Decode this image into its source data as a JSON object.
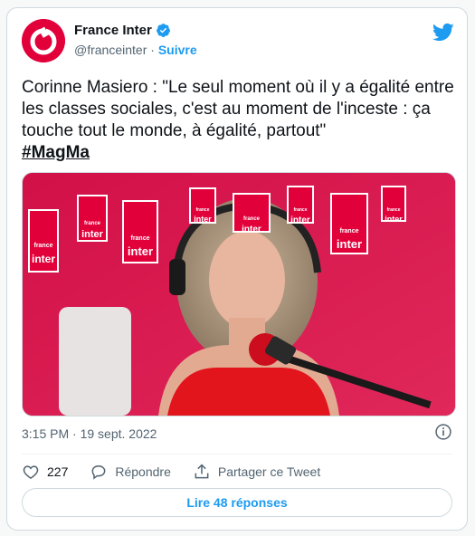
{
  "account": {
    "display_name": "France Inter",
    "handle": "@franceinter",
    "separator": "·",
    "follow_label": "Suivre"
  },
  "tweet": {
    "text": "Corinne Masiero  : \"Le seul moment où il y a égalité entre les classes sociales, c'est au moment de l'inceste : ça touche tout le monde, à égalité, partout\"",
    "hashtag": "#MagMa",
    "timestamp": "3:15 PM · 19 sept. 2022"
  },
  "media": {
    "brand_small": "france",
    "brand_large": "inter"
  },
  "actions": {
    "like_count": "227",
    "reply_label": "Répondre",
    "share_label": "Partager ce Tweet"
  },
  "footer": {
    "read_replies_label": "Lire 48 réponses"
  },
  "colors": {
    "brand_red": "#e2003b",
    "twitter_blue": "#1d9bf0",
    "studio_red": "#d7194c"
  },
  "icons": [
    "france-inter-logo",
    "verified-badge-icon",
    "twitter-bird-icon",
    "info-icon",
    "heart-icon",
    "reply-icon",
    "share-icon"
  ]
}
